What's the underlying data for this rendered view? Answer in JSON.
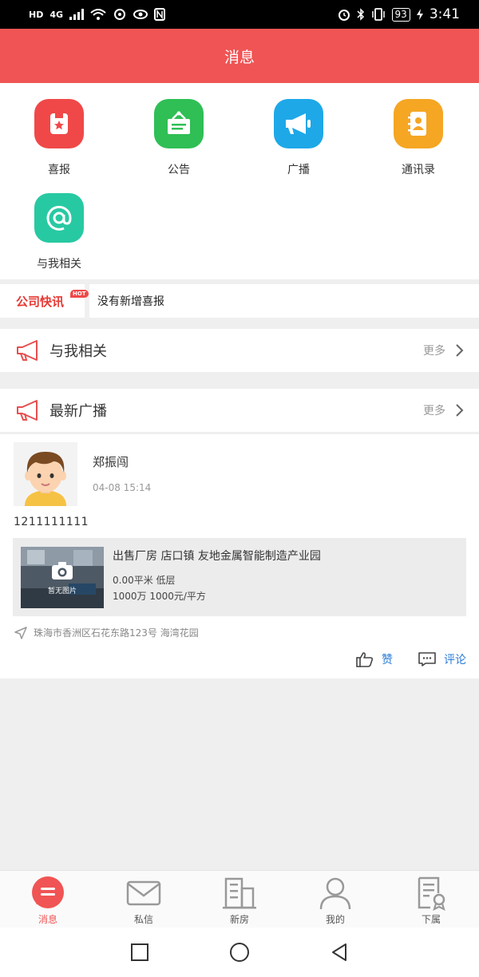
{
  "status_bar": {
    "left_icons": [
      "HD",
      "4G"
    ],
    "battery": "93",
    "time": "3:41"
  },
  "header": {
    "title": "消息"
  },
  "grid": [
    {
      "label": "喜报",
      "icon": "certificate-icon",
      "color": "#f04848"
    },
    {
      "label": "公告",
      "icon": "notice-board-icon",
      "color": "#2fbf55"
    },
    {
      "label": "广播",
      "icon": "megaphone-icon",
      "color": "#1ea8e8"
    },
    {
      "label": "通讯录",
      "icon": "contacts-book-icon",
      "color": "#f5a623"
    },
    {
      "label": "与我相关",
      "icon": "at-icon",
      "color": "#27c9a2"
    }
  ],
  "ticker": {
    "tag": "公司快讯",
    "badge": "HOT",
    "text": "没有新增喜报"
  },
  "sections": {
    "related": {
      "title": "与我相关",
      "more": "更多"
    },
    "broadcast": {
      "title": "最新广播",
      "more": "更多"
    }
  },
  "post": {
    "author": "郑振闯",
    "time": "04-08 15:14",
    "text": "1211111111",
    "listing": {
      "title": "出售厂房 店口镇 友地金属智能制造产业园",
      "no_image": "暂无图片",
      "line1": "0.00平米 低层",
      "line2": "1000万 1000元/平方"
    },
    "location": "珠海市香洲区石花东路123号 海湾花园",
    "like_label": "赞",
    "comment_label": "评论"
  },
  "tabs": [
    {
      "label": "消息",
      "icon": "message-icon",
      "active": true
    },
    {
      "label": "私信",
      "icon": "envelope-icon",
      "active": false
    },
    {
      "label": "新房",
      "icon": "building-icon",
      "active": false
    },
    {
      "label": "我的",
      "icon": "person-icon",
      "active": false
    },
    {
      "label": "下属",
      "icon": "document-badge-icon",
      "active": false
    }
  ],
  "colors": {
    "brand": "#f05454",
    "link": "#2a7bd6"
  }
}
